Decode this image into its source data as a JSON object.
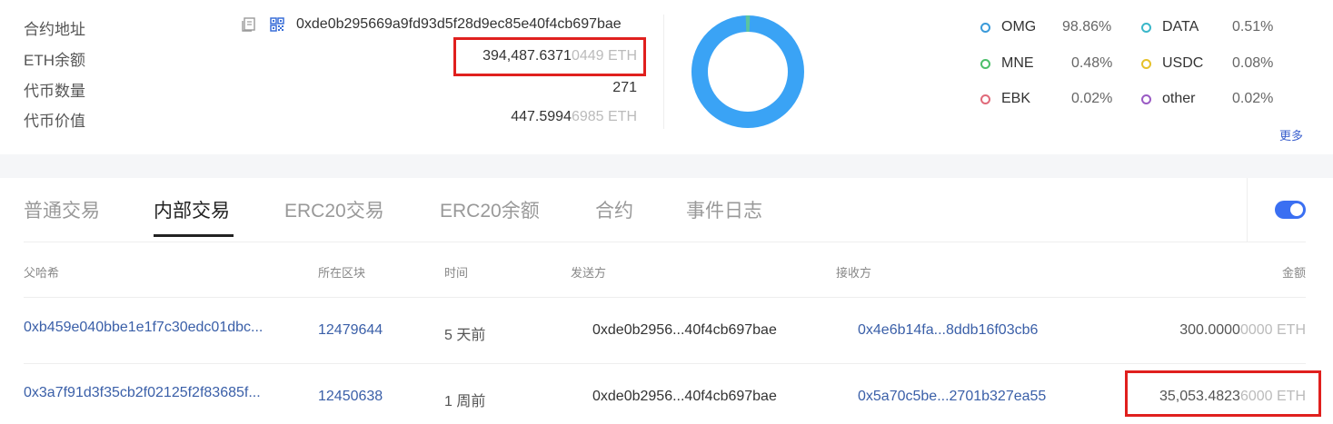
{
  "info": {
    "contract_label": "合约地址",
    "contract_address": "0xde0b295669a9fd93d5f28d9ec85e40f4cb697bae",
    "eth_balance_label": "ETH余额",
    "eth_balance_main": "394,487.6371",
    "eth_balance_dim": "0449 ETH",
    "token_count_label": "代币数量",
    "token_count": "271",
    "token_value_label": "代币价值",
    "token_value_main": "447.5994",
    "token_value_dim": "6985 ETH"
  },
  "legend": [
    {
      "name": "OMG",
      "pct": "98.86%",
      "color": "#3a9ad9"
    },
    {
      "name": "DATA",
      "pct": "0.51%",
      "color": "#3ab7c9"
    },
    {
      "name": "MNE",
      "pct": "0.48%",
      "color": "#4cbf6a"
    },
    {
      "name": "USDC",
      "pct": "0.08%",
      "color": "#e6c12a"
    },
    {
      "name": "EBK",
      "pct": "0.02%",
      "color": "#e06a7a"
    },
    {
      "name": "other",
      "pct": "0.02%",
      "color": "#9a5bc4"
    }
  ],
  "more_label": "更多",
  "donut": {
    "main_color": "#3aa3f5",
    "accent_color": "#5bc4a0"
  },
  "tabs": [
    {
      "label": "普通交易"
    },
    {
      "label": "内部交易"
    },
    {
      "label": "ERC20交易"
    },
    {
      "label": "ERC20余额"
    },
    {
      "label": "合约"
    },
    {
      "label": "事件日志"
    }
  ],
  "active_tab": "内部交易",
  "table": {
    "headers": {
      "parent_hash": "父哈希",
      "block": "所在区块",
      "time": "时间",
      "from": "发送方",
      "to": "接收方",
      "amount": "金额"
    },
    "rows": [
      {
        "parent_hash": "0xb459e040bbe1e1f7c30edc01dbc...",
        "block": "12479644",
        "time": "5 天前",
        "from": "0xde0b2956...40f4cb697bae",
        "to": "0x4e6b14fa...8ddb16f03cb6",
        "amount_main": "300.0000",
        "amount_dim": "0000 ETH"
      },
      {
        "parent_hash": "0x3a7f91d3f35cb2f02125f2f83685f...",
        "block": "12450638",
        "time": "1 周前",
        "from": "0xde0b2956...40f4cb697bae",
        "to": "0x5a70c5be...2701b327ea55",
        "amount_main": "35,053.4823",
        "amount_dim": "6000 ETH"
      }
    ]
  },
  "highlight_color": "#e0201e"
}
